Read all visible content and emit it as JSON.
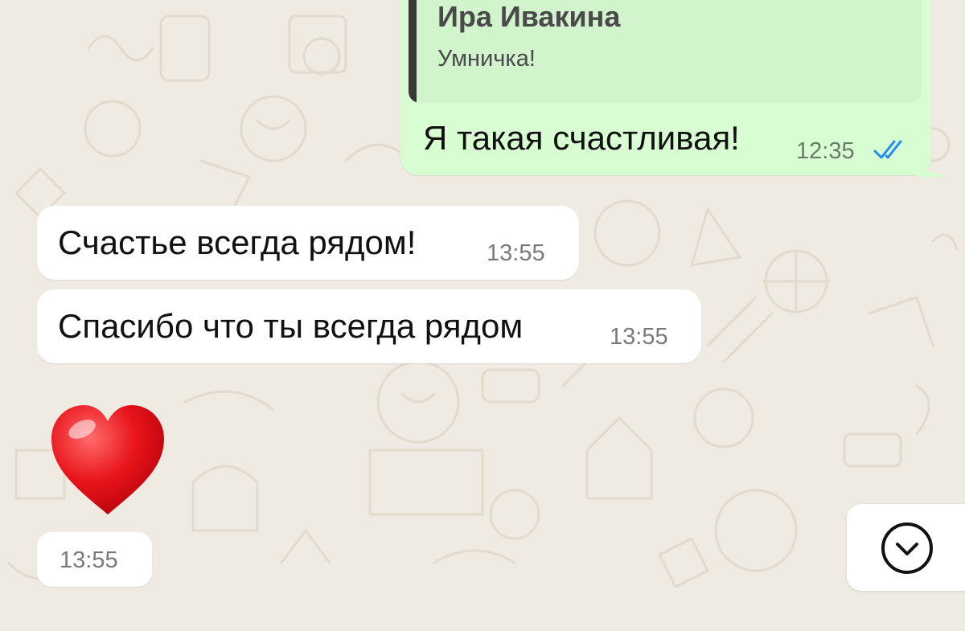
{
  "outgoing_message": {
    "quote_author": "Ира Ивакина",
    "quote_text": "Умничка!",
    "text": "Я такая счастливая!",
    "time": "12:35",
    "status_icon": "double-check-read-icon",
    "status_color": "#1f8cf0"
  },
  "incoming_messages": [
    {
      "text": "Счастье всегда рядом!",
      "time": "13:55"
    },
    {
      "text": "Спасибо что ты всегда рядом",
      "time": "13:55"
    },
    {
      "emoji": "red-heart-icon",
      "time": "13:55"
    }
  ],
  "scroll_button": {
    "icon": "chevron-down-icon"
  },
  "colors": {
    "background": "#efeae2",
    "outgoing_bubble": "#d9fdd3",
    "incoming_bubble": "#ffffff",
    "quote_background": "#d1f4cc"
  }
}
